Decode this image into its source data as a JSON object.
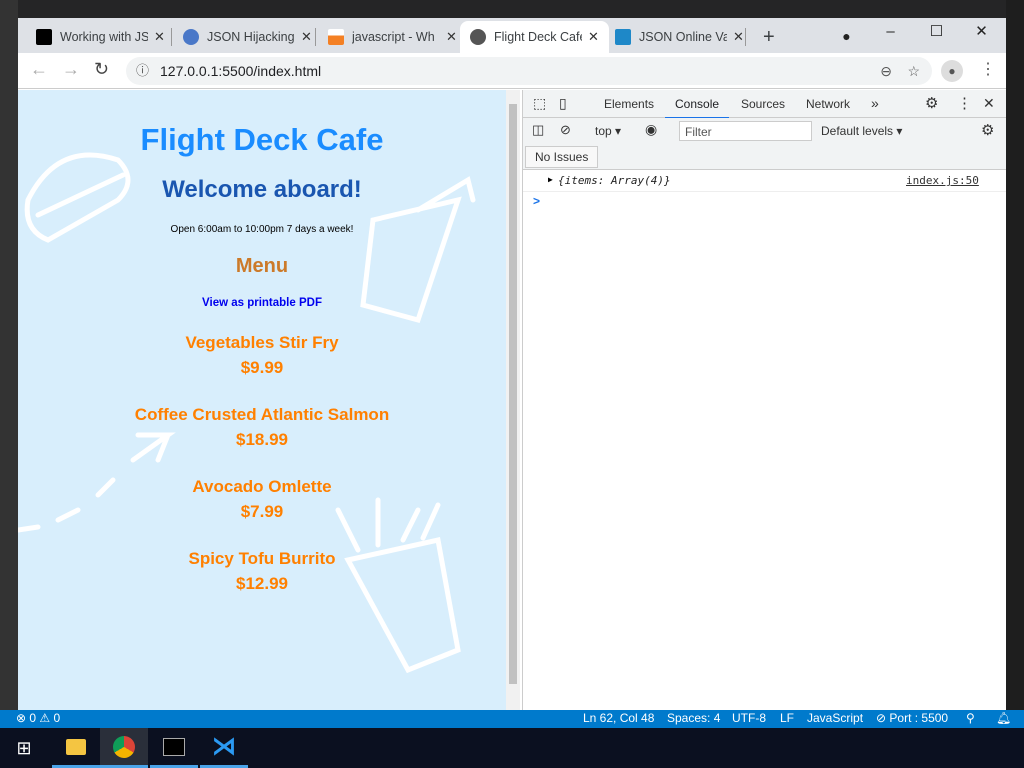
{
  "browser": {
    "tabs": [
      {
        "label": "Working with JS",
        "active": false
      },
      {
        "label": "JSON Hijacking",
        "active": false
      },
      {
        "label": "javascript - Wh",
        "active": false
      },
      {
        "label": "Flight Deck Cafe",
        "active": true
      },
      {
        "label": "JSON Online Va",
        "active": false
      }
    ],
    "new_tab": "+",
    "url": "127.0.0.1:5500/index.html"
  },
  "page": {
    "title": "Flight Deck Cafe",
    "welcome": "Welcome aboard!",
    "hours": "Open 6:00am to 10:00pm 7 days a week!",
    "menu_heading": "Menu",
    "pdf_link": "View as printable PDF",
    "items": [
      {
        "name": "Vegetables Stir Fry",
        "price": "$9.99"
      },
      {
        "name": "Coffee Crusted Atlantic Salmon",
        "price": "$18.99"
      },
      {
        "name": "Avocado Omlette",
        "price": "$7.99"
      },
      {
        "name": "Spicy Tofu Burrito",
        "price": "$12.99"
      }
    ]
  },
  "devtools": {
    "tabs": [
      "Elements",
      "Console",
      "Sources",
      "Network"
    ],
    "active_tab": "Console",
    "more": "»",
    "context": "top",
    "filter_placeholder": "Filter",
    "levels": "Default levels",
    "issues": "No Issues",
    "log": {
      "text": "{items: Array(4)}",
      "source": "index.js:50"
    },
    "prompt": ">"
  },
  "statusbar": {
    "problems": "⊗ 0 ⚠ 0",
    "position": "Ln 62, Col 48",
    "spaces": "Spaces: 4",
    "encoding": "UTF-8",
    "eol": "LF",
    "language": "JavaScript",
    "port": "⊘ Port : 5500"
  },
  "colors": {
    "title": "#1a8cff",
    "welcome": "#1a56b0",
    "menu": "#cc7a29",
    "item": "#ff8000",
    "link": "#0000ee",
    "status": "#007acc"
  }
}
